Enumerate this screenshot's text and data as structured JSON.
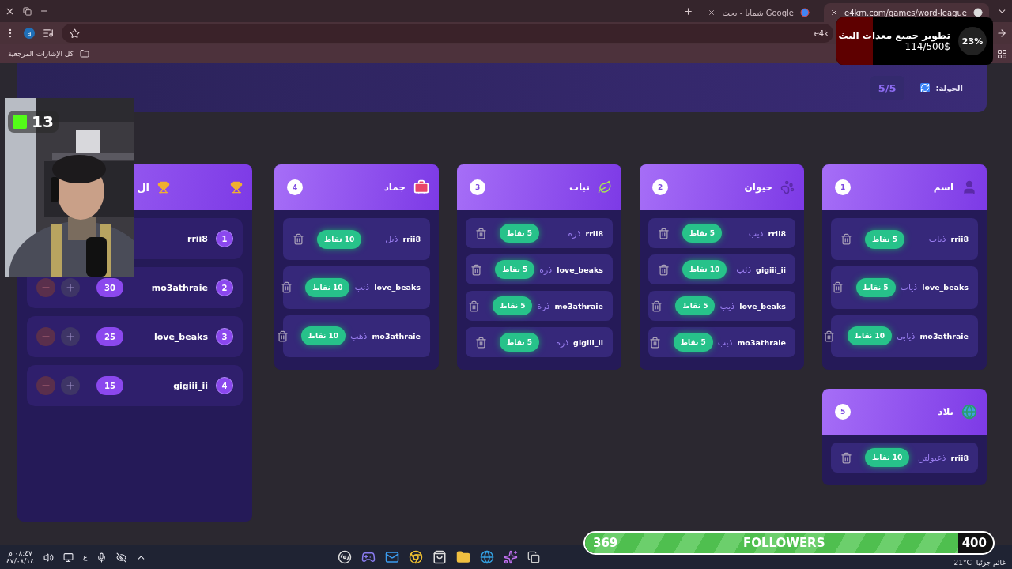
{
  "browser": {
    "tabs": [
      {
        "title": "e4km.com/games/word-league",
        "selected": true
      },
      {
        "title": "شمايا - بحث Google",
        "selected": false
      }
    ],
    "profile": "a",
    "address": "e4k",
    "bookmarks": [
      "كل الإشارات المرجعية"
    ]
  },
  "donation_widget": {
    "percent": "23%",
    "title": "تطوير جميع معدات البث",
    "amount": "114/500$",
    "level": 0.23
  },
  "round": {
    "label": "الجولة:",
    "value": "5/5"
  },
  "webcam": {
    "kind": "picture",
    "badge": "13"
  },
  "leaderboard": {
    "title": "ال",
    "players": [
      {
        "rank": "1",
        "name": "rrii8"
      },
      {
        "rank": "2",
        "name": "mo3athraie",
        "score": "30"
      },
      {
        "rank": "3",
        "name": "love_beaks",
        "score": "25"
      },
      {
        "rank": "4",
        "name": "gigiii_ii",
        "score": "15"
      }
    ]
  },
  "categories": [
    {
      "number": "1",
      "title": "اسم",
      "kind": "person",
      "answers": [
        {
          "player": "rrii8",
          "word": "ذياب",
          "points": "5 نقاط"
        },
        {
          "player": "love_beaks",
          "word": "ذياب",
          "points": "5 نقاط"
        },
        {
          "player": "mo3athraie",
          "word": "ذيابي",
          "points": "10 نقاط"
        }
      ]
    },
    {
      "number": "2",
      "title": "حيوان",
      "kind": "paw",
      "answers": [
        {
          "player": "rrii8",
          "word": "ذيب",
          "points": "5 نقاط"
        },
        {
          "player": "gigiii_ii",
          "word": "ذئب",
          "points": "10 نقاط"
        },
        {
          "player": "love_beaks",
          "word": "ذيب",
          "points": "5 نقاط"
        },
        {
          "player": "mo3athraie",
          "word": "ذيب",
          "points": "5 نقاط"
        }
      ]
    },
    {
      "number": "3",
      "title": "نبات",
      "kind": "leaf",
      "answers": [
        {
          "player": "rrii8",
          "word": "ذره",
          "points": "5 نقاط"
        },
        {
          "player": "love_beaks",
          "word": "ذره",
          "points": "5 نقاط"
        },
        {
          "player": "mo3athraie",
          "word": "ذرة",
          "points": "5 نقاط"
        },
        {
          "player": "gigiii_ii",
          "word": "ذره",
          "points": "5 نقاط"
        }
      ]
    },
    {
      "number": "4",
      "title": "جماد",
      "kind": "toolbox",
      "answers": [
        {
          "player": "rrii8",
          "word": "ذيل",
          "points": "10 نقاط"
        },
        {
          "player": "love_beaks",
          "word": "ذنب",
          "points": "10 نقاط"
        },
        {
          "player": "mo3athraie",
          "word": "ذهب",
          "points": "10 نقاط"
        }
      ]
    },
    {
      "number": "5",
      "title": "بلاد",
      "kind": "globe",
      "answers": [
        {
          "player": "rrii8",
          "word": "ذعبولتن",
          "points": "10 نقاط"
        }
      ]
    }
  ],
  "followers_goal": {
    "current": "369",
    "label": "FOLLOWERS",
    "goal": "400",
    "level": 0.915
  },
  "taskbar": {
    "time": "٠٨:٤٧ م",
    "date": "٤٧/٠٨/١٤",
    "language": "ع",
    "temperature": "21°C",
    "weather": "غائم جزئيا"
  }
}
